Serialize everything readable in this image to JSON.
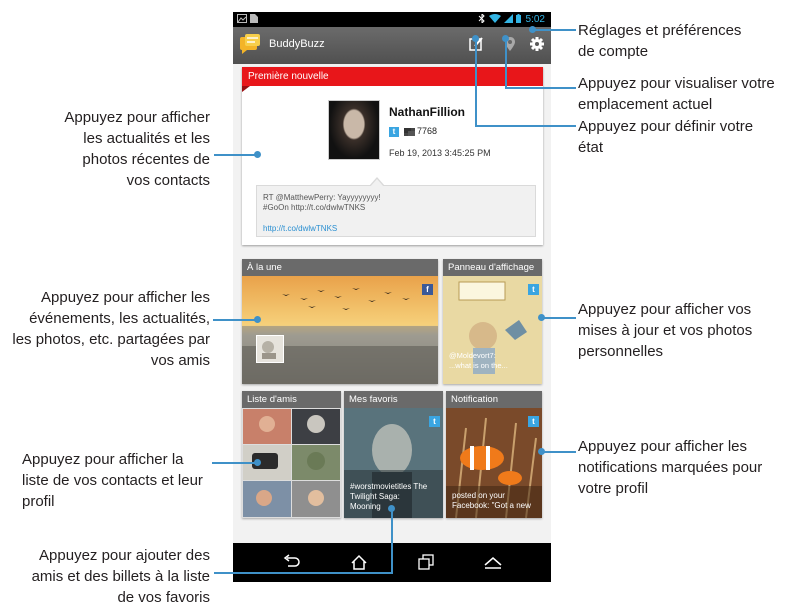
{
  "app": {
    "title": "BuddyBuzz",
    "status_time": "5:02"
  },
  "news_card": {
    "header": "Première nouvelle",
    "user": "NathanFillion",
    "twitter_badge": "t",
    "followers": "7768",
    "timestamp": "Feb 19, 2013 3:45:25 PM",
    "tweet": "RT @MatthewPerry: Yayyyyyyyy!\n#GoOn http://t.co/dwlwTNKS",
    "link": "http://t.co/dwlwTNKS"
  },
  "tiles": {
    "a_la_une": {
      "label": "À la une",
      "badge": "f"
    },
    "panneau": {
      "label": "Panneau d'affichage",
      "badge": "t",
      "caption": "@Moldevort7:\n...what is on the..."
    },
    "liste_amis": {
      "label": "Liste d'amis"
    },
    "mes_favoris": {
      "label": "Mes favoris",
      "badge": "t",
      "caption": "#worstmovietitles The\nTwilight Saga:\nMooning"
    },
    "notification": {
      "label": "Notification",
      "badge": "t",
      "caption": "posted on your\nFacebook: \"Got a new"
    }
  },
  "callouts": {
    "settings": [
      "Réglages et préférences",
      "de compte"
    ],
    "location": [
      "Appuyez pour visualiser votre",
      "emplacement actuel"
    ],
    "status": [
      "Appuyez pour définir votre",
      "état"
    ],
    "news": [
      "Appuyez pour afficher",
      "les actualités et les",
      "photos récentes de",
      "vos contacts"
    ],
    "events": [
      "Appuyez pour afficher les",
      "événements, les actualités,",
      "les photos, etc. partagées par",
      "vos amis"
    ],
    "updates": [
      "Appuyez pour afficher vos",
      "mises à jour et vos photos",
      "personnelles"
    ],
    "friends": [
      "Appuyez pour afficher la",
      "liste de vos contacts et leur",
      "profil"
    ],
    "notifications": [
      "Appuyez pour afficher les",
      "notifications marquées pour",
      "votre profil"
    ],
    "favorites": [
      "Appuyez pour ajouter des",
      "amis et des billets à la liste",
      "de vos favoris"
    ]
  },
  "colors": {
    "callout_line": "#3f91c8",
    "news_header": "#e8161a",
    "action_bar": "#5a5a5a",
    "twitter": "#3aa5e1",
    "facebook": "#3b5998"
  },
  "icons": [
    "compose-icon",
    "location-pin-icon",
    "gear-icon",
    "back-icon",
    "home-icon",
    "recent-apps-icon",
    "menu-up-icon"
  ]
}
